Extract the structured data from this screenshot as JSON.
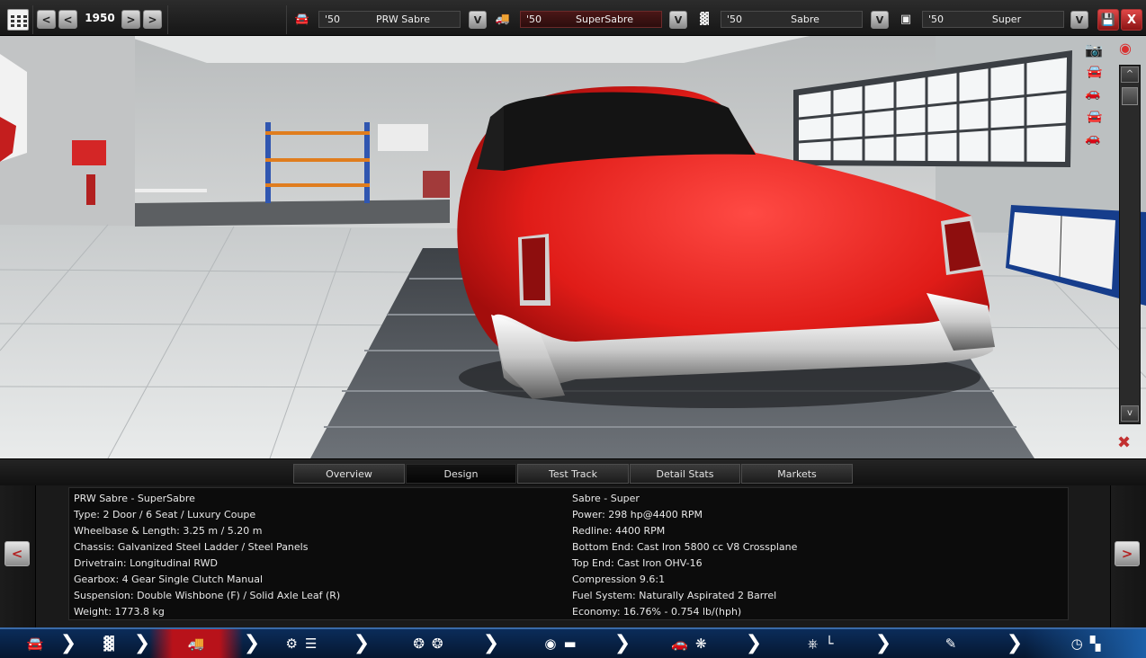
{
  "topbar": {
    "year": "1950",
    "prev_label": "<",
    "prev2_label": "<",
    "next_label": ">",
    "next2_label": ">",
    "dropdown_label": "V",
    "selectors": [
      {
        "year": "'50",
        "name": "PRW Sabre"
      },
      {
        "year": "'50",
        "name": "SuperSabre"
      },
      {
        "year": "'50",
        "name": "Sabre"
      },
      {
        "year": "'50",
        "name": "Super"
      }
    ],
    "close_label": "X"
  },
  "tabs": [
    "Overview",
    "Design",
    "Test Track",
    "Detail Stats",
    "Markets"
  ],
  "active_tab": "Design",
  "info": {
    "left": [
      "PRW Sabre - SuperSabre",
      "Type: 2 Door / 6 Seat / Luxury Coupe",
      "Wheelbase & Length: 3.25 m / 5.20 m",
      "Chassis: Galvanized Steel Ladder / Steel Panels",
      "Drivetrain: Longitudinal RWD",
      "Gearbox: 4 Gear Single Clutch Manual",
      "Suspension: Double Wishbone (F) / Solid Axle Leaf (R)",
      "Weight: 1773.8 kg"
    ],
    "right": [
      "Sabre - Super",
      "Power: 298 hp@4400 RPM",
      "Redline: 4400 RPM",
      "Bottom End: Cast Iron 5800 cc V8 Crossplane",
      "Top End: Cast Iron OHV-16",
      "Compression 9.6:1",
      "Fuel System: Naturally Aspirated 2 Barrel",
      "Economy: 16.76% - 0.754 lb/(hph)"
    ]
  },
  "nav": {
    "prev_label": "<",
    "next_label": ">"
  },
  "scroll": {
    "up_label": "^",
    "down_label": "v"
  },
  "colors": {
    "accent_red": "#b8121a",
    "nav_blue": "#0b2c5a",
    "car_red": "#e0201c"
  }
}
